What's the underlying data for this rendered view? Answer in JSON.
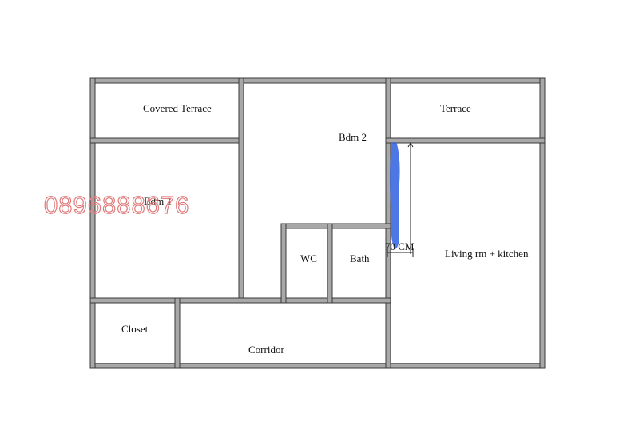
{
  "rooms": {
    "covered_terrace": "Covered Terrace",
    "bdm2": "Bdm 2",
    "terrace": "Terrace",
    "bdm1": "Bdm 1",
    "wc": "WC",
    "bath": "Bath",
    "living": "Living rm + kitchen",
    "closet": "Closet",
    "corridor": "Corridor"
  },
  "dimension": {
    "label": "70 CM"
  },
  "watermark": "0896888676",
  "colors": {
    "wall": "#a8a8a8",
    "highlight": "#2e5fe0",
    "watermark": "#e07a7a"
  }
}
